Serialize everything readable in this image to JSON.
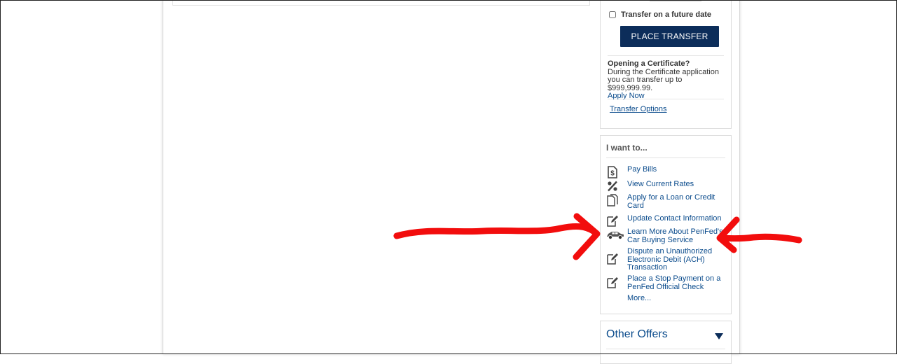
{
  "transfer": {
    "future_date_label": "Transfer on a future date",
    "future_date_checked": false,
    "place_button": "PLACE TRANSFER",
    "certificate_title": "Opening a Certificate?",
    "certificate_text": "During the Certificate application you can transfer up to $999,999.99.",
    "apply_link": "Apply Now",
    "options_link": "Transfer Options"
  },
  "i_want": {
    "title": "I want to...",
    "items": [
      {
        "label": "Pay Bills",
        "icon": "dollar-document-icon"
      },
      {
        "label": "View Current Rates",
        "icon": "percent-icon"
      },
      {
        "label": "Apply for a Loan or Credit Card",
        "icon": "documents-icon"
      },
      {
        "label": "Update Contact Information",
        "icon": "edit-icon"
      },
      {
        "label": "Learn More About PenFed's Car Buying Service",
        "icon": "car-icon"
      },
      {
        "label": "Dispute an Unauthorized Electronic Debit (ACH) Transaction",
        "icon": "edit-icon"
      },
      {
        "label": "Place a Stop Payment on a PenFed Official Check",
        "icon": "edit-icon"
      }
    ],
    "more_link": "More..."
  },
  "other_offers": {
    "title": "Other Offers",
    "icon": "triangle-down-icon"
  },
  "colors": {
    "brand_navy": "#0c2d5a",
    "link_blue": "#0a4b8c",
    "annotation_red": "#f20d0d"
  }
}
